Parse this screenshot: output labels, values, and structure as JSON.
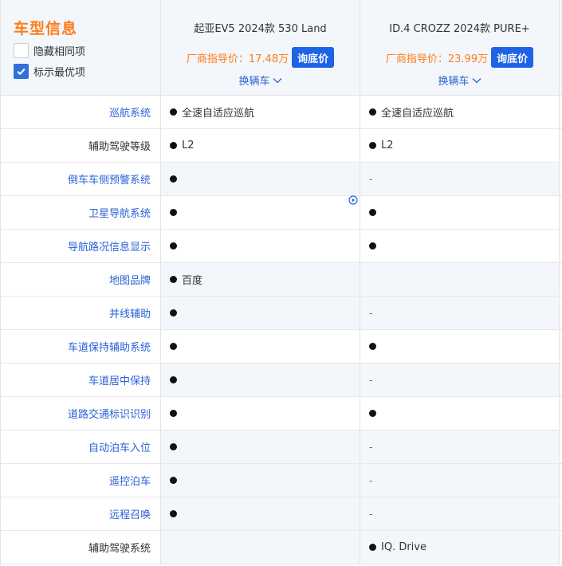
{
  "header": {
    "title": "车型信息",
    "options": [
      {
        "label": "隐藏相同项",
        "checked": false
      },
      {
        "label": "标示最优项",
        "checked": true
      }
    ],
    "cars": [
      {
        "name": "起亚EV5 2024款 530 Land",
        "price_label": "厂商指导价：17.48万",
        "ask_label": "询底价",
        "swap_label": "换辆车"
      },
      {
        "name": "ID.4 CROZZ 2024款 PURE+",
        "price_label": "厂商指导价：23.99万",
        "ask_label": "询底价",
        "swap_label": "换辆车"
      }
    ]
  },
  "rows": [
    {
      "label": "巡航系统",
      "link": true,
      "diff": false,
      "v1": {
        "dot": true,
        "text": "全速自适应巡航"
      },
      "v2": {
        "dot": true,
        "text": "全速自适应巡航"
      }
    },
    {
      "label": "辅助驾驶等级",
      "link": false,
      "diff": false,
      "v1": {
        "dot": true,
        "text": "L2"
      },
      "v2": {
        "dot": true,
        "text": "L2"
      }
    },
    {
      "label": "倒车车侧预警系统",
      "link": true,
      "diff": true,
      "v1": {
        "dot": true,
        "text": ""
      },
      "v2": {
        "dot": false,
        "text": "-"
      }
    },
    {
      "label": "卫星导航系统",
      "link": true,
      "diff": false,
      "v1": {
        "dot": true,
        "text": ""
      },
      "v2": {
        "dot": true,
        "text": ""
      }
    },
    {
      "label": "导航路况信息显示",
      "link": true,
      "diff": false,
      "v1": {
        "dot": true,
        "text": ""
      },
      "v2": {
        "dot": true,
        "text": ""
      }
    },
    {
      "label": "地图品牌",
      "link": true,
      "diff": true,
      "v1": {
        "dot": true,
        "text": "百度"
      },
      "v2": {
        "dot": false,
        "text": ""
      }
    },
    {
      "label": "并线辅助",
      "link": true,
      "diff": true,
      "v1": {
        "dot": true,
        "text": ""
      },
      "v2": {
        "dot": false,
        "text": "-"
      }
    },
    {
      "label": "车道保持辅助系统",
      "link": true,
      "diff": false,
      "v1": {
        "dot": true,
        "text": ""
      },
      "v2": {
        "dot": true,
        "text": ""
      }
    },
    {
      "label": "车道居中保持",
      "link": true,
      "diff": true,
      "v1": {
        "dot": true,
        "text": ""
      },
      "v2": {
        "dot": false,
        "text": "-"
      }
    },
    {
      "label": "道路交通标识识别",
      "link": true,
      "diff": false,
      "v1": {
        "dot": true,
        "text": ""
      },
      "v2": {
        "dot": true,
        "text": ""
      }
    },
    {
      "label": "自动泊车入位",
      "link": true,
      "diff": true,
      "v1": {
        "dot": true,
        "text": ""
      },
      "v2": {
        "dot": false,
        "text": "-"
      }
    },
    {
      "label": "遥控泊车",
      "link": true,
      "diff": true,
      "v1": {
        "dot": true,
        "text": ""
      },
      "v2": {
        "dot": false,
        "text": "-"
      }
    },
    {
      "label": "远程召唤",
      "link": true,
      "diff": true,
      "v1": {
        "dot": true,
        "text": ""
      },
      "v2": {
        "dot": false,
        "text": "-"
      }
    },
    {
      "label": "辅助驾驶系统",
      "link": false,
      "diff": true,
      "v1": {
        "dot": false,
        "text": ""
      },
      "v2": {
        "dot": true,
        "text": "IQ. Drive"
      }
    }
  ]
}
